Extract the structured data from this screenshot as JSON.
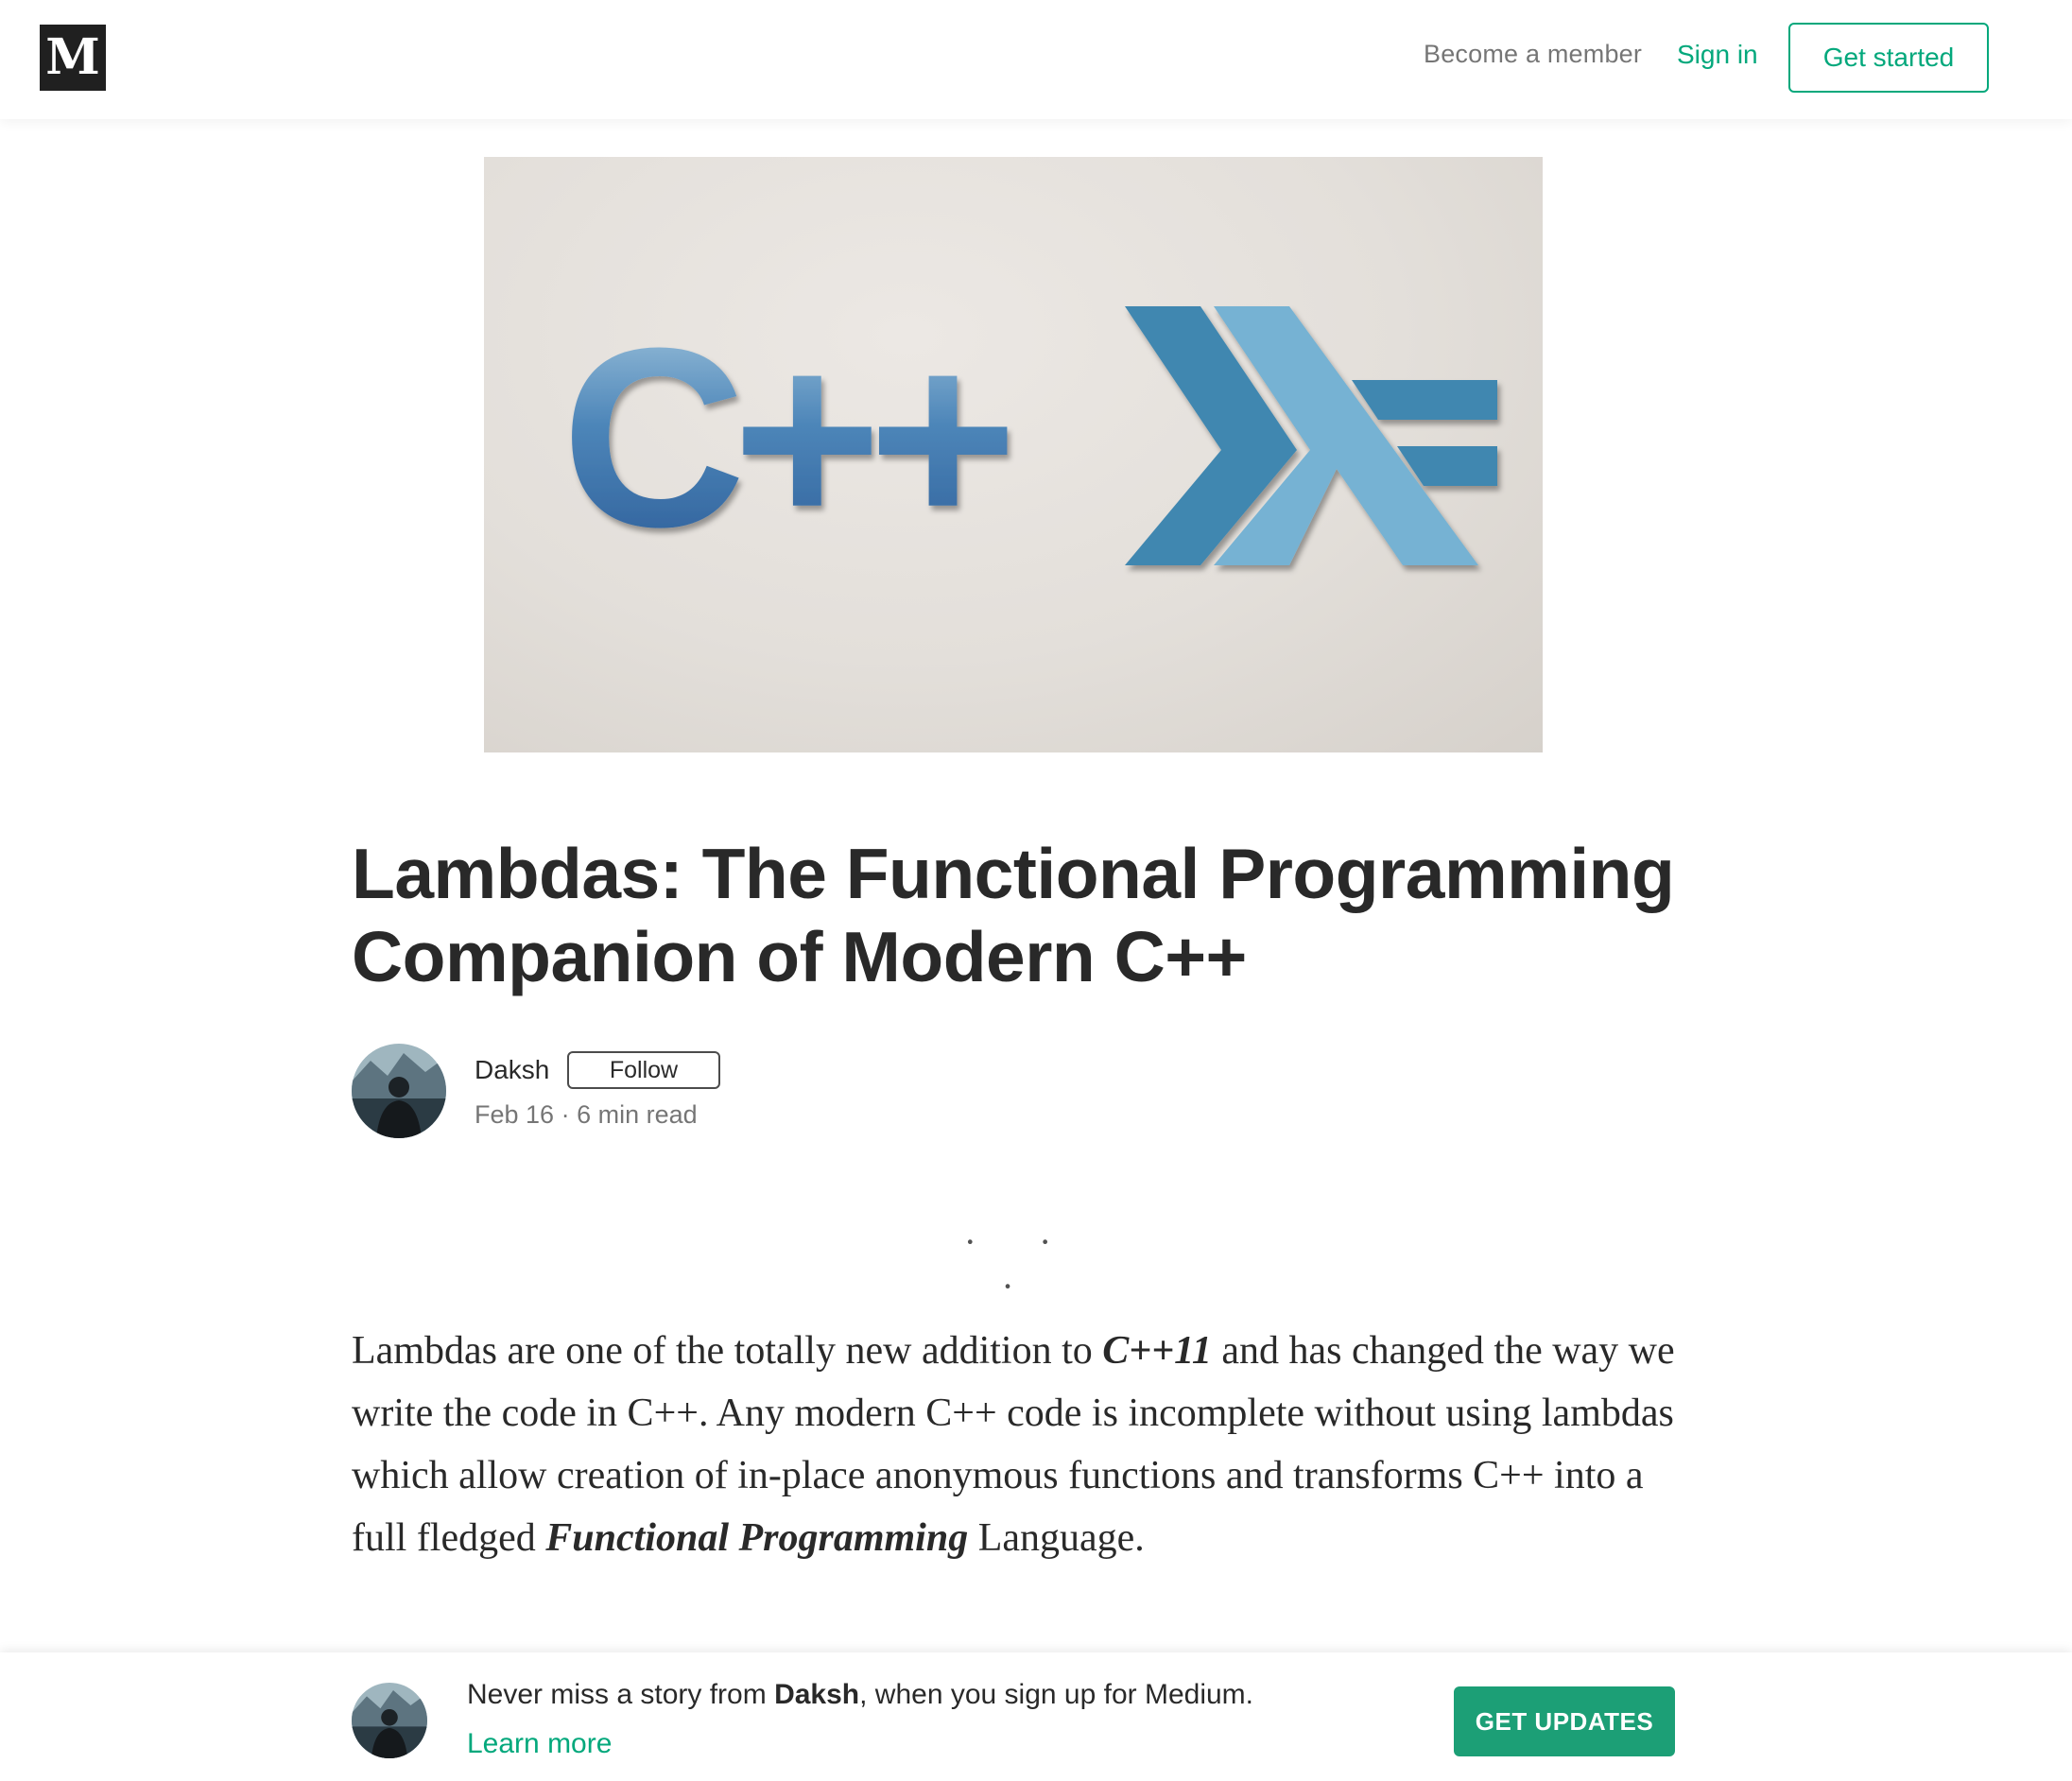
{
  "nav": {
    "logo": "M",
    "become_member": "Become a member",
    "sign_in": "Sign in",
    "get_started": "Get started"
  },
  "hero": {
    "logo_text": "C++"
  },
  "article": {
    "title": "Lambdas: The Functional Programming Companion of Modern C++",
    "author": "Daksh",
    "follow": "Follow",
    "date": "Feb 16",
    "separator": " · ",
    "read_time": "6 min read",
    "divider": "· · ·",
    "paragraph": {
      "p1": "Lambdas are one of the totally new addition to ",
      "em1": "C++11",
      "p2": " and has changed the way we write the code in C++. Any modern C++ code is incomplete without using lambdas which allow creation of in-place anonymous functions and transforms C++ into a full fledged ",
      "em2": "Functional Programming",
      "p3": " Language."
    }
  },
  "banner": {
    "text_before": "Never miss a story from ",
    "author": "Daksh",
    "text_after": ", when you sign up for Medium.",
    "learn_more": "Learn more",
    "button": "GET UPDATES"
  },
  "colors": {
    "accent": "#03a87c",
    "button_bg": "#1c9f76",
    "logo_bg": "#202020"
  }
}
